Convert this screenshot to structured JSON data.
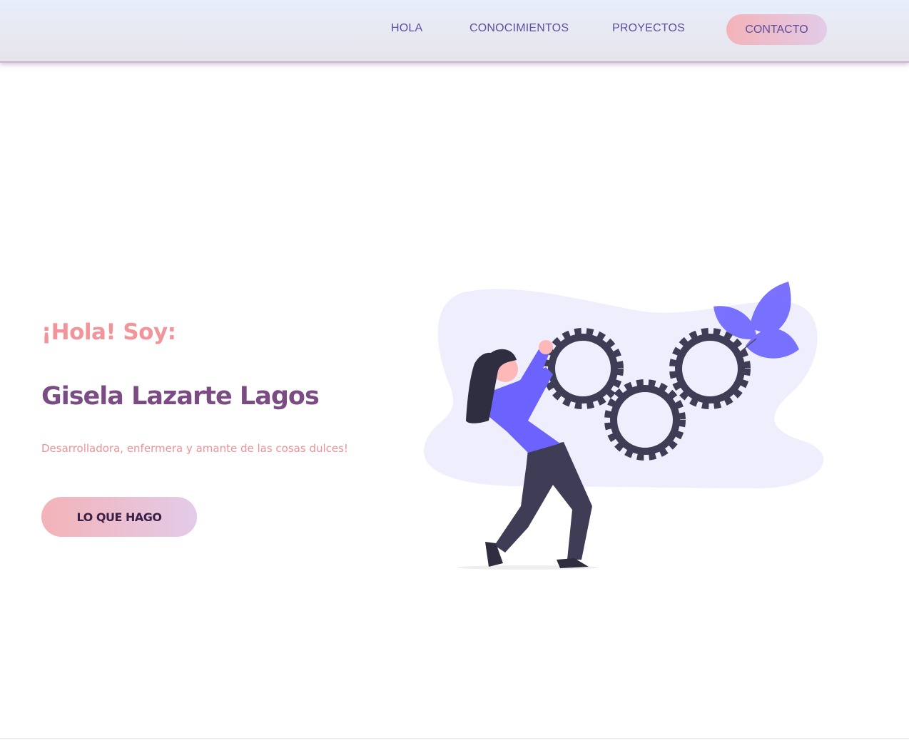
{
  "nav": {
    "items": [
      {
        "label": "HOLA"
      },
      {
        "label": "CONOCIMIENTOS"
      },
      {
        "label": "PROYECTOS"
      }
    ],
    "contact_label": "CONTACTO"
  },
  "hero": {
    "greeting": "¡Hola! Soy:",
    "name": "Gisela Lazarte Lagos",
    "tagline": "Desarrolladora, enfermera y amante de las cosas dulces!",
    "cta_label": "LO QUE HAGO"
  },
  "illustration": {
    "subject": "woman turning gears",
    "colors": {
      "blob": "#efeefc",
      "gear": "#3f3d56",
      "accent": "#6c63ff",
      "skin": "#ffb8b8",
      "hair": "#2f2e41"
    }
  },
  "colors": {
    "nav_text": "#5b4f9e",
    "greeting": "#f2959b",
    "name": "#7b4c83",
    "tagline": "#ee9196",
    "button_gradient_start": "#f3b3b8",
    "button_gradient_end": "#e3cbe8"
  }
}
